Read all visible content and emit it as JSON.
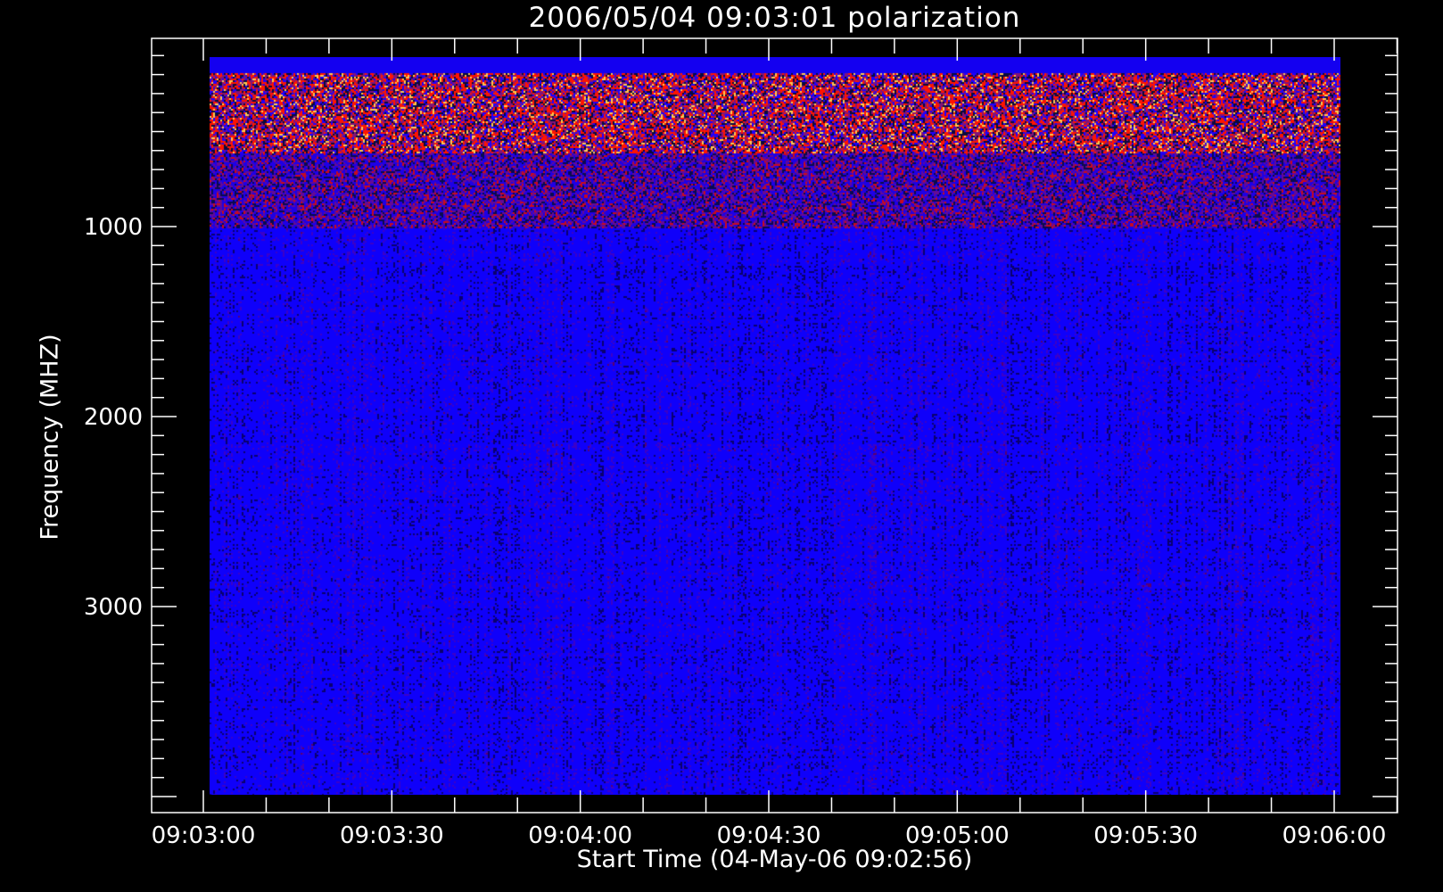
{
  "chart_data": {
    "type": "heatmap",
    "title": "2006/05/04 09:03:01 polarization",
    "xlabel": "Start Time (04-May-06 09:02:56)",
    "ylabel": "Frequency (MHZ)",
    "x_ticks": [
      "09:03:00",
      "09:03:30",
      "09:04:00",
      "09:04:30",
      "09:05:00",
      "09:05:30",
      "09:06:00"
    ],
    "x_tick_seconds": [
      0,
      30,
      60,
      90,
      120,
      150,
      180
    ],
    "x_minor_step_seconds": 10,
    "xlim_seconds": [
      -9,
      210
    ],
    "y_ticks": [
      "1000",
      "2000",
      "3000"
    ],
    "y_tick_values": [
      1000,
      2000,
      3000
    ],
    "y_minor_step": 100,
    "ylim": [
      4085,
      10
    ],
    "data_x_range_seconds": [
      1,
      181
    ],
    "data_y_range": [
      100,
      3990
    ],
    "bands": [
      {
        "from": 100,
        "to": 180,
        "level": "saturated-blue"
      },
      {
        "from": 180,
        "to": 600,
        "level": "high-noise"
      },
      {
        "from": 600,
        "to": 1000,
        "level": "medium-noise"
      },
      {
        "from": 1000,
        "to": 3990,
        "level": "low-blue"
      }
    ],
    "colors": {
      "background": "#000000",
      "low": "#0000ff",
      "mid": "#ff0000",
      "high": "#ffff80",
      "axis": "#ffffff"
    }
  }
}
